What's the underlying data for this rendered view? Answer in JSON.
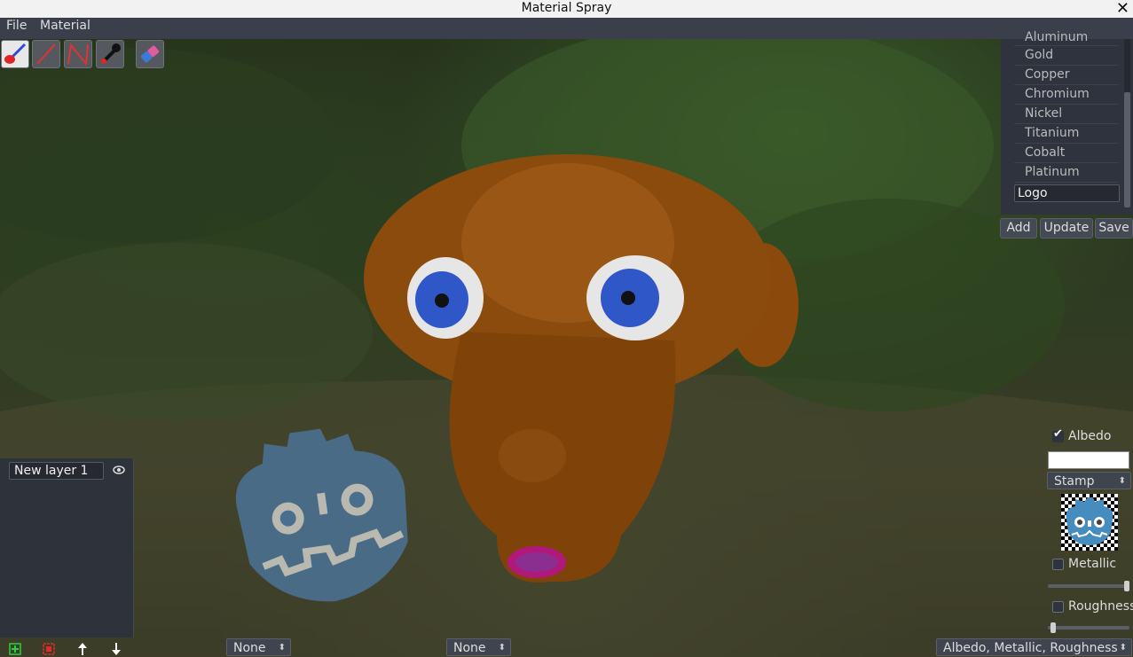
{
  "window": {
    "title": "Material Spray"
  },
  "menu": {
    "file": "File",
    "material": "Material"
  },
  "tools": [
    "paint-brush-icon",
    "line-icon",
    "line-strip-icon",
    "eyedropper-icon",
    "eraser-icon"
  ],
  "materials": {
    "items": [
      "Aluminum",
      "Gold",
      "Copper",
      "Chromium",
      "Nickel",
      "Titanium",
      "Cobalt",
      "Platinum"
    ],
    "name_value": "Logo",
    "add_label": "Add",
    "update_label": "Update",
    "save_label": "Save"
  },
  "layers": {
    "items": [
      {
        "name": "New layer 1"
      }
    ]
  },
  "channels": {
    "albedo_label": "Albedo",
    "albedo_checked": true,
    "albedo_color": "#ffffff",
    "mode_value": "Stamp",
    "metallic_label": "Metallic",
    "metallic_checked": false,
    "metallic_value": 1.0,
    "roughness_label": "Roughness",
    "roughness_checked": false,
    "roughness_value": 0.0
  },
  "bottom": {
    "select_1": "None",
    "select_2": "None",
    "select_3": "Albedo, Metallic, Roughness"
  }
}
